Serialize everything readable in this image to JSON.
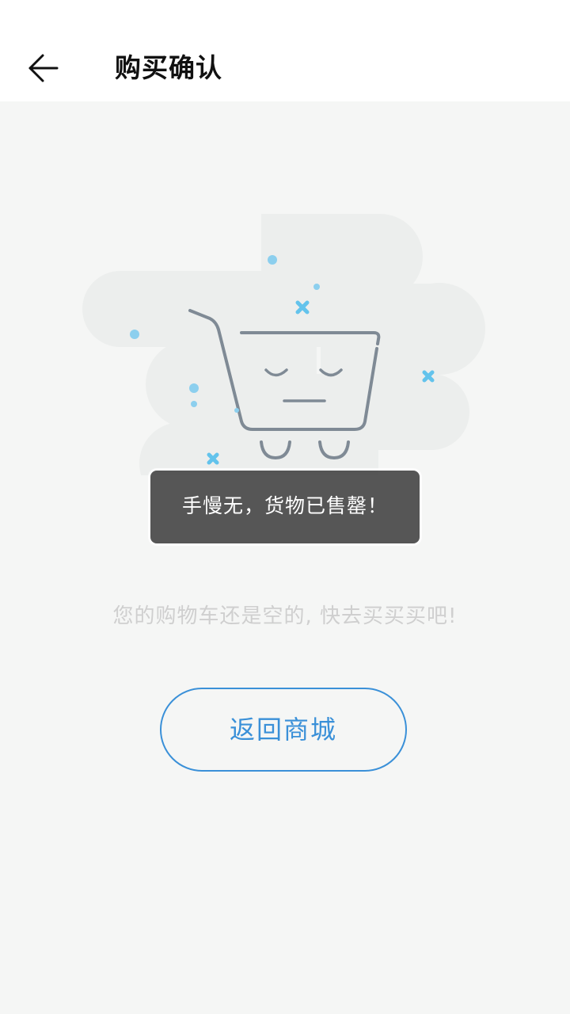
{
  "header": {
    "title": "购买确认",
    "back_icon": "arrow-left-icon"
  },
  "toast": {
    "text": "手慢无，货物已售罄！"
  },
  "empty_state": {
    "illustration_icon": "sad-shopping-cart-icon",
    "message": "您的购物车还是空的, 快去买买买吧!"
  },
  "actions": {
    "return_label": "返回商城"
  },
  "colors": {
    "background": "#f5f6f5",
    "header_background": "#ffffff",
    "accent": "#3a90d8",
    "toast_background": "#4b4b4b",
    "muted_text": "#cfcfcf"
  }
}
